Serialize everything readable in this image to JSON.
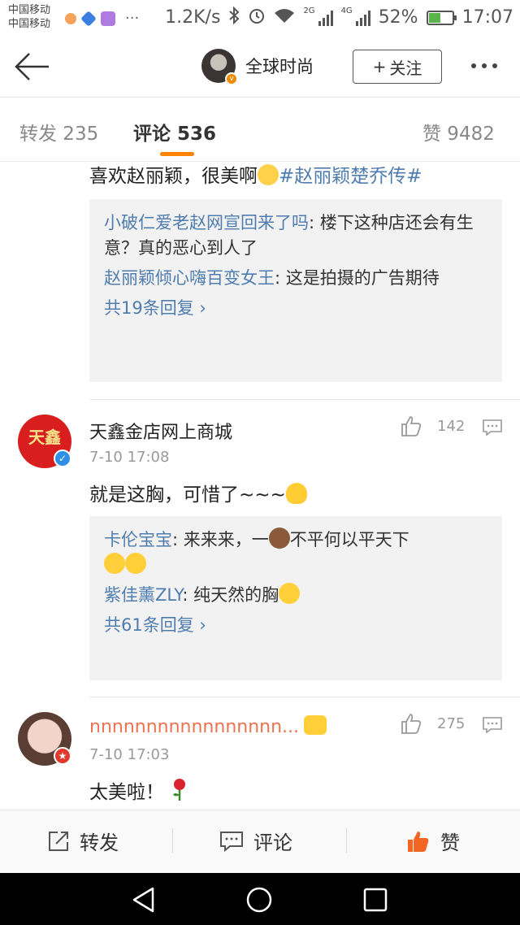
{
  "status_bar": {
    "carrier_1": "中国移动",
    "carrier_2": "中国移动",
    "net_speed": "1.2K/s",
    "net_2g": "2G",
    "net_4g": "4G",
    "battery": "52%",
    "battery_level": 0.52,
    "time": "17:07"
  },
  "nav": {
    "title": "全球时尚",
    "follow_label": "关注",
    "follow_plus": "+"
  },
  "tabs": {
    "repost": "转发 235",
    "comments": "评论 536",
    "likes": "赞 9482"
  },
  "comment0": {
    "text": "喜欢赵丽颖，很美啊",
    "topic": "#赵丽颖楚乔传#",
    "replies": [
      {
        "user": "小破仁爱老赵网宣回来了吗",
        "text": ": 楼下这种店还会有生意？真的恶心到人了"
      },
      {
        "user": "赵丽颖倾心嗨百变女王",
        "text": ": 这是拍摄的广告期待"
      }
    ],
    "more_replies": "共19条回复"
  },
  "comment1": {
    "name": "天鑫金店网上商城",
    "avatar_text": "天鑫",
    "time": "7-10 17:08",
    "likes": "142",
    "text": "就是这胸，可惜了~~~",
    "replies": [
      {
        "user": "卡伦宝宝",
        "text": ": 来来来，一",
        "text_2": "不平何以平天下"
      },
      {
        "user": "紫佳薰ZLY",
        "text": ": 纯天然的胸"
      }
    ],
    "more_replies": "共61条回复"
  },
  "comment2": {
    "name": "nnnnnnnnnnnnnnnnn...",
    "time": "7-10 17:03",
    "likes": "275",
    "text": "太美啦！"
  },
  "actions": {
    "repost": "转发",
    "comment": "评论",
    "like": "赞"
  },
  "colors": {
    "accent": "#ff8200",
    "link": "#507daf",
    "like_orange": "#f26522",
    "name_orange": "#eb7350"
  }
}
